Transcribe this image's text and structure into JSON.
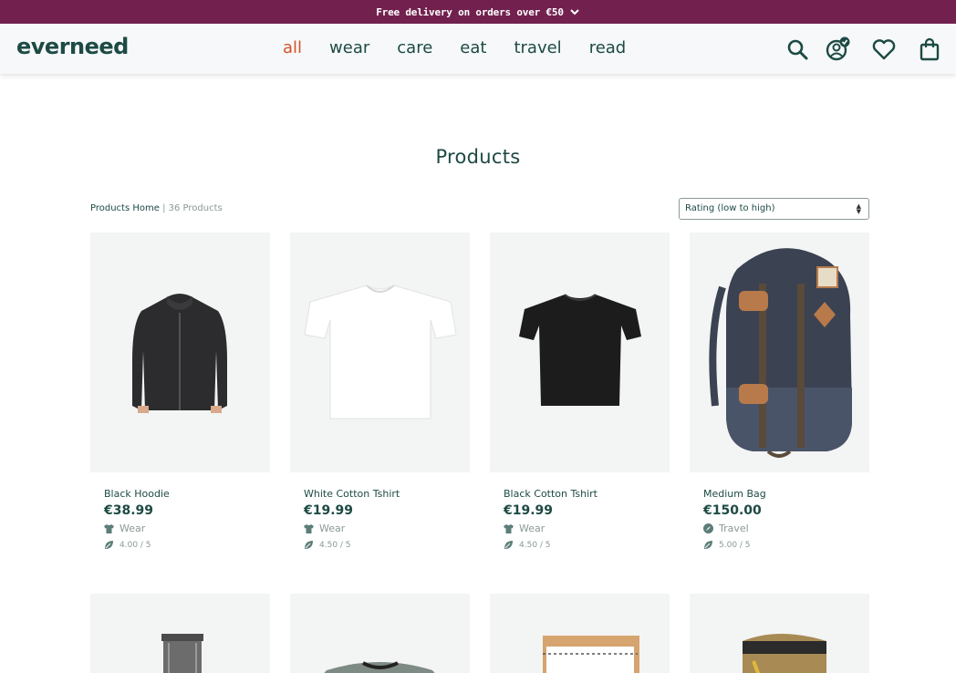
{
  "promo": {
    "text": "Free delivery on orders over €50",
    "icon": "chevron-down-icon"
  },
  "header": {
    "logo": "everneed",
    "nav": [
      {
        "label": "all",
        "active": true
      },
      {
        "label": "wear",
        "active": false
      },
      {
        "label": "care",
        "active": false
      },
      {
        "label": "eat",
        "active": false
      },
      {
        "label": "travel",
        "active": false
      },
      {
        "label": "read",
        "active": false
      }
    ],
    "icons": [
      "search-icon",
      "account-verified-icon",
      "heart-icon",
      "shopping-bag-icon"
    ]
  },
  "page": {
    "title": "Products"
  },
  "breadcrumb": {
    "home": "Products Home",
    "separator": " | ",
    "count": "36 Products"
  },
  "sort": {
    "selected": "Rating (low to high)"
  },
  "colors": {
    "brand": "#1d4a44",
    "promo": "#72214f",
    "active": "#d4532a",
    "muted": "#8a9a98"
  },
  "products": [
    {
      "name": "Black Hoodie",
      "price": "€38.99",
      "category": "Wear",
      "category_icon": "tshirt-icon",
      "rating": "4.00 / 5"
    },
    {
      "name": "White Cotton Tshirt",
      "price": "€19.99",
      "category": "Wear",
      "category_icon": "tshirt-icon",
      "rating": "4.50 / 5"
    },
    {
      "name": "Black Cotton Tshirt",
      "price": "€19.99",
      "category": "Wear",
      "category_icon": "tshirt-icon",
      "rating": "4.50 / 5"
    },
    {
      "name": "Medium Bag",
      "price": "€150.00",
      "category": "Travel",
      "category_icon": "compass-icon",
      "rating": "5.00 / 5"
    }
  ]
}
